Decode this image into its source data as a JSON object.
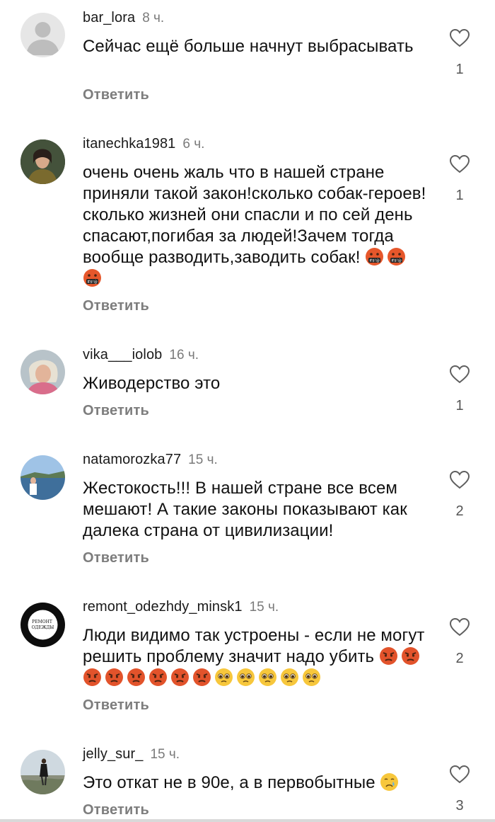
{
  "reply_label": "Ответить",
  "comments": [
    {
      "username": "bar_lora",
      "time": "8 ч.",
      "text": "Сейчас ещё больше начнут выбрасывать",
      "likes": "1",
      "avatar": "default-avatar"
    },
    {
      "username": "itanechka1981",
      "time": "6 ч.",
      "text": "очень очень жаль что в нашей стране приняли такой закон!сколько собак-героев!сколько жизней они спасли и по сей день спасают,погибая за людей!Зачем тогда вообще разводить,заводить собак!",
      "emojis": "🤬🤬🤬",
      "likes": "1",
      "avatar": "photo-avatar"
    },
    {
      "username": "vika___iolob",
      "time": "16 ч.",
      "text": "Живодерство это",
      "likes": "1",
      "avatar": "photo-avatar"
    },
    {
      "username": "natamorozka77",
      "time": "15 ч.",
      "text": "Жестокость!!! В нашей стране все всем мешают! А такие законы показывают как далека страна от цивилизации!",
      "likes": "2",
      "avatar": "photo-avatar"
    },
    {
      "username": "remont_odezhdy_minsk1",
      "time": "15 ч.",
      "text": "Люди видимо так устроены - если не могут решить проблему значит надо убить",
      "emojis": "😡😡😡😡😡😡😡😡🥺🥺🥺🥺🥺",
      "likes": "2",
      "avatar": "logo-avatar",
      "avatar_text": "РЕМОНТ ОДЕЖДЫ"
    },
    {
      "username": "jelly_sur_",
      "time": "15 ч.",
      "text": "Это откат не в 90е, а в первобытные",
      "emojis": "😢",
      "likes": "3",
      "avatar": "photo-avatar"
    }
  ],
  "colors": {
    "background": "#ffffff",
    "text": "#111111",
    "secondary_text": "#7a7a7a",
    "heart_outline": "#5f5f5f"
  }
}
